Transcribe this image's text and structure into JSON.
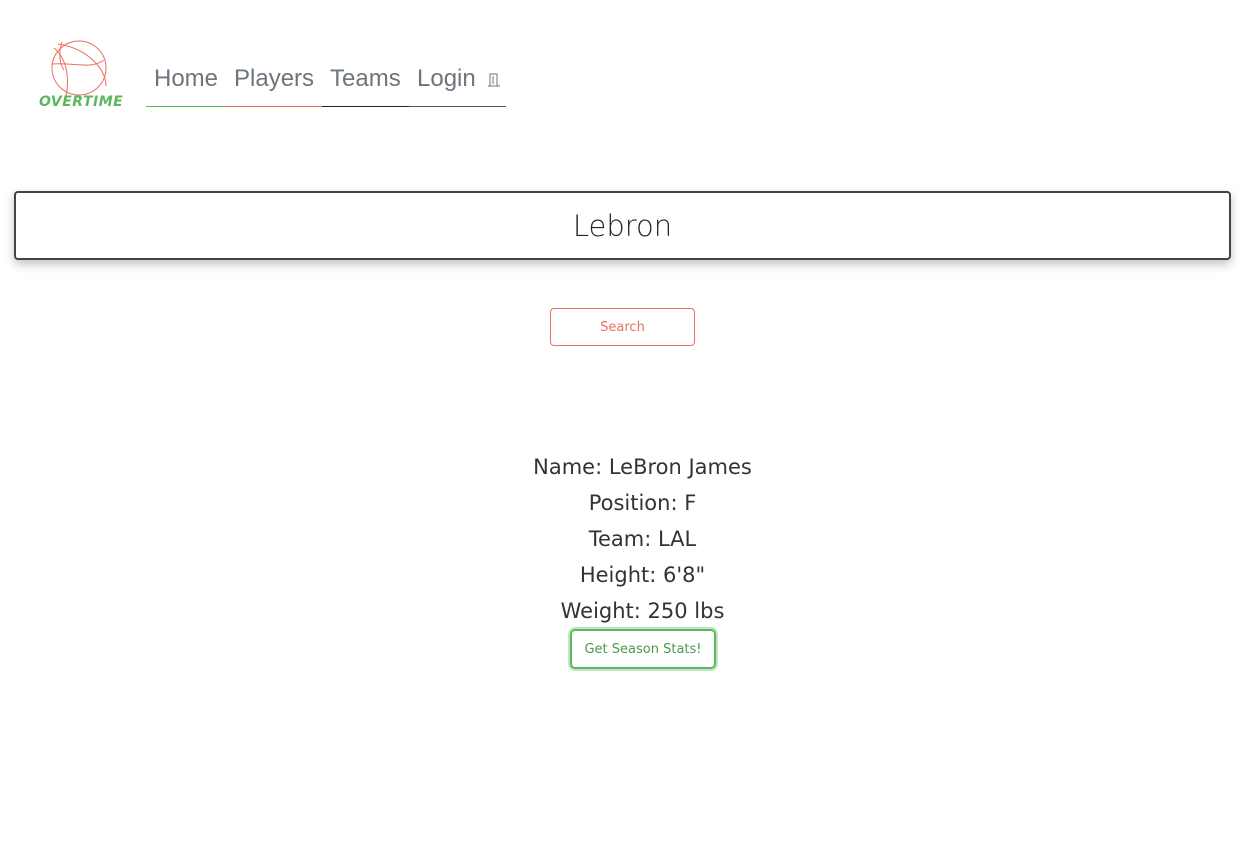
{
  "logo": {
    "text": "OVERTIME",
    "icon": "basketball-icon",
    "colors": {
      "ball": "#e8725f",
      "text": "#5cb85c"
    }
  },
  "nav": {
    "items": [
      {
        "label": "Home"
      },
      {
        "label": "Players"
      },
      {
        "label": "Teams"
      },
      {
        "label": "Login",
        "icon": "login-icon"
      }
    ]
  },
  "search": {
    "value": "Lebron",
    "button_label": "Search"
  },
  "player": {
    "name": "Name: LeBron James",
    "position": "Position: F",
    "team": "Team: LAL",
    "height": "Height: 6'8\"",
    "weight": "Weight: 250 lbs",
    "stats_button_label": "Get Season Stats!"
  },
  "colors": {
    "accent_red": "#e8725f",
    "accent_green": "#5cb85c",
    "nav_text": "#6c757d"
  }
}
